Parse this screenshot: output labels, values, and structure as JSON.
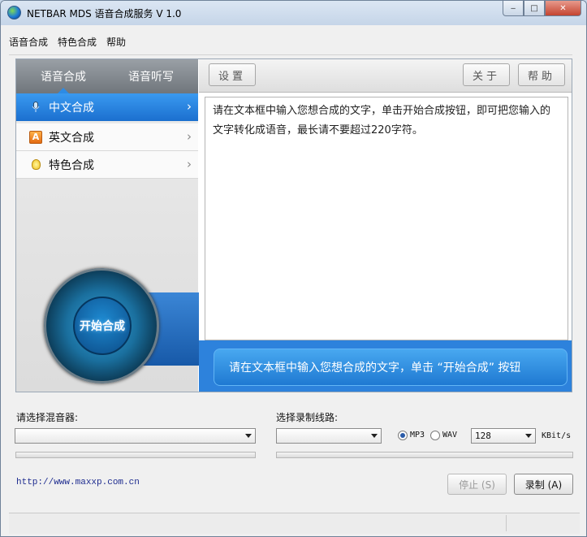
{
  "window": {
    "title": "NETBAR MDS 语音合成服务 V 1.0",
    "min": "‒",
    "max": "□",
    "close": "✕"
  },
  "menu": [
    "语音合成",
    "特色合成",
    "帮助"
  ],
  "sidebar": {
    "tabs": [
      "语音合成",
      "语音听写"
    ],
    "items": [
      {
        "label": "中文合成",
        "icon": "microphone-icon"
      },
      {
        "label": "英文合成",
        "icon": "letter-a-icon",
        "glyph": "A"
      },
      {
        "label": "特色合成",
        "icon": "lightbulb-icon"
      }
    ],
    "start_button": "开始合成"
  },
  "toolbar": {
    "settings": "设置",
    "about": "关于",
    "help": "帮助"
  },
  "textbox": {
    "text": "请在文本框中输入您想合成的文字，单击开始合成按钮，即可把您输入的文字转化成语音，最长请不要超过220字符。"
  },
  "hint": "请在文本框中输入您想合成的文字，单击 “开始合成” 按钮",
  "mixer": {
    "label": "请选择混音器:",
    "value": ""
  },
  "record_line": {
    "label": "选择录制线路:",
    "value": ""
  },
  "format": {
    "mp3": "MP3",
    "wav": "WAV",
    "selected": "MP3"
  },
  "bitrate": {
    "value": "128",
    "unit": "KBit/s"
  },
  "link": "http://www.maxxp.com.cn",
  "buttons": {
    "stop": "停止 (S)",
    "record": "录制 (A)"
  }
}
